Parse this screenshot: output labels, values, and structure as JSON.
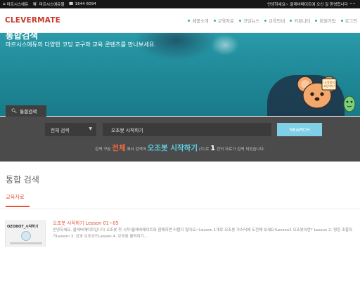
{
  "topbar": {
    "links": [
      {
        "icon": "home-icon",
        "label": "마르시스에듀"
      },
      {
        "icon": "cart-icon",
        "label": "마르시스에듀몰"
      },
      {
        "icon": "phone-icon",
        "label": "1644 6094"
      }
    ],
    "notice": "안녕하세요~ 클레버메이트에 오신 걸 환영합니다 ^^"
  },
  "header": {
    "logo": "CLEVERMATE",
    "nav": [
      "제품소개",
      "교육자료",
      "코딩뉴스",
      "교육안내",
      "커뮤니티",
      "회원가입",
      "로그인"
    ]
  },
  "hero": {
    "title": "통합검색",
    "subtitle": "마르시스에듀의 다양한 코딩 교구와 교육 콘텐츠를 만나보세요.",
    "mascot_sign": "내 작품이 코딩이다!"
  },
  "search": {
    "tab_label": "통합검색",
    "select_value": "전체 검색",
    "query": "오조봇 시작하기",
    "button": "SEARCH",
    "summary": {
      "prefix": "검색 구분",
      "category": "전체",
      "mid": "에서 검색어",
      "term": "오조봇 시작하기",
      "mid2": "(으)로",
      "count": "1",
      "suffix": "건의 자료가 검색 되었습니다."
    }
  },
  "results": {
    "title": "통합 검색",
    "category_tab": "교육자료",
    "items": [
      {
        "thumb_label": "OZOBOT_시작하기",
        "title": "오조봇 시작하기 Lesson 01~05",
        "description": "안녕하세요. 클레버메이트입니다 오조봇 첫 시작!클레버메이트와 함께하면 어렵지 않아요~Lesson 1개로 오조봇 가스터에 도전해 보세요!Lesson1 오조봇이란? Lesson 2. 명칭 조합하기Lesson 3. 선과 오조코드Lesson 4. 오조봇 움직이기..."
      }
    ]
  },
  "colors": {
    "accent_orange": "#e2553a",
    "accent_cyan": "#5ed3e6",
    "search_button": "#7fd0e6",
    "hero_teal": "#1e8796"
  }
}
